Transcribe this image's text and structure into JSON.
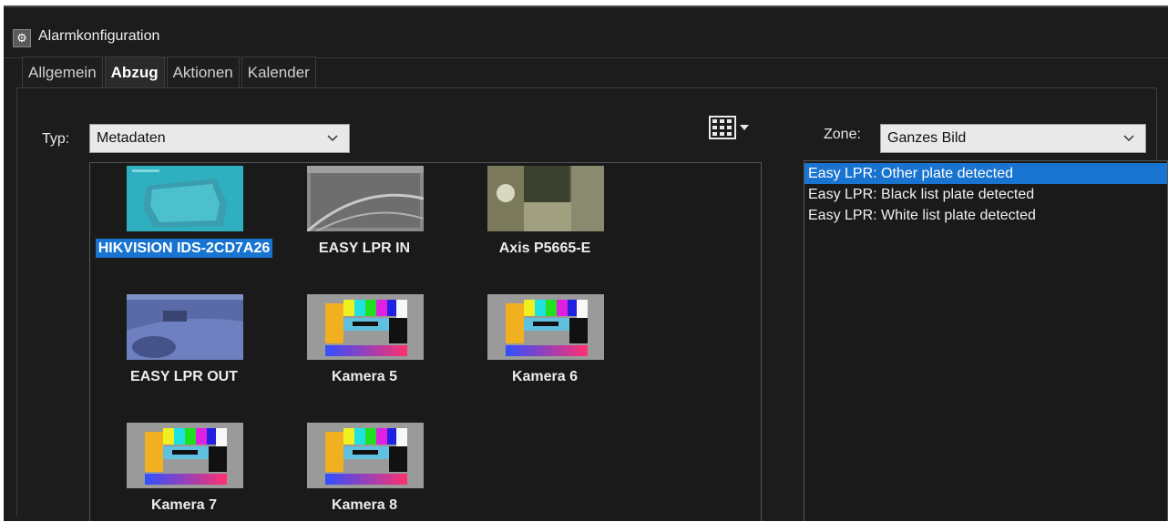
{
  "window": {
    "title": "Alarmkonfiguration",
    "icon": "gears-icon"
  },
  "tabs": [
    {
      "label": "Allgemein",
      "active": false
    },
    {
      "label": "Abzug",
      "active": true
    },
    {
      "label": "Aktionen",
      "active": false
    },
    {
      "label": "Kalender",
      "active": false
    }
  ],
  "typ": {
    "label": "Typ:",
    "value": "Metadaten"
  },
  "view_button": {
    "icon": "grid-view-icon",
    "dropdown_icon": "caret-down-icon"
  },
  "cameras": [
    {
      "name": "HIKVISION IDS-2CD7A26",
      "selected": true,
      "thumb": "cyan-scene"
    },
    {
      "name": "EASY LPR IN",
      "selected": false,
      "thumb": "grey-road"
    },
    {
      "name": "Axis P5665-E",
      "selected": false,
      "thumb": "garden"
    },
    {
      "name": "EASY LPR OUT",
      "selected": false,
      "thumb": "blue-parking"
    },
    {
      "name": "Kamera 5",
      "selected": false,
      "thumb": "test-card"
    },
    {
      "name": "Kamera 6",
      "selected": false,
      "thumb": "test-card"
    },
    {
      "name": "Kamera 7",
      "selected": false,
      "thumb": "test-card"
    },
    {
      "name": "Kamera 8",
      "selected": false,
      "thumb": "test-card"
    }
  ],
  "zone": {
    "label": "Zone:",
    "value": "Ganzes Bild"
  },
  "events": [
    {
      "label": "Easy LPR: Other plate detected",
      "selected": true
    },
    {
      "label": "Easy LPR: Black list plate detected",
      "selected": false
    },
    {
      "label": "Easy LPR: White list plate detected",
      "selected": false
    }
  ],
  "colors": {
    "background": "#1c1c1c",
    "selection": "#1874d0",
    "select_bg": "#e9e9e9"
  }
}
